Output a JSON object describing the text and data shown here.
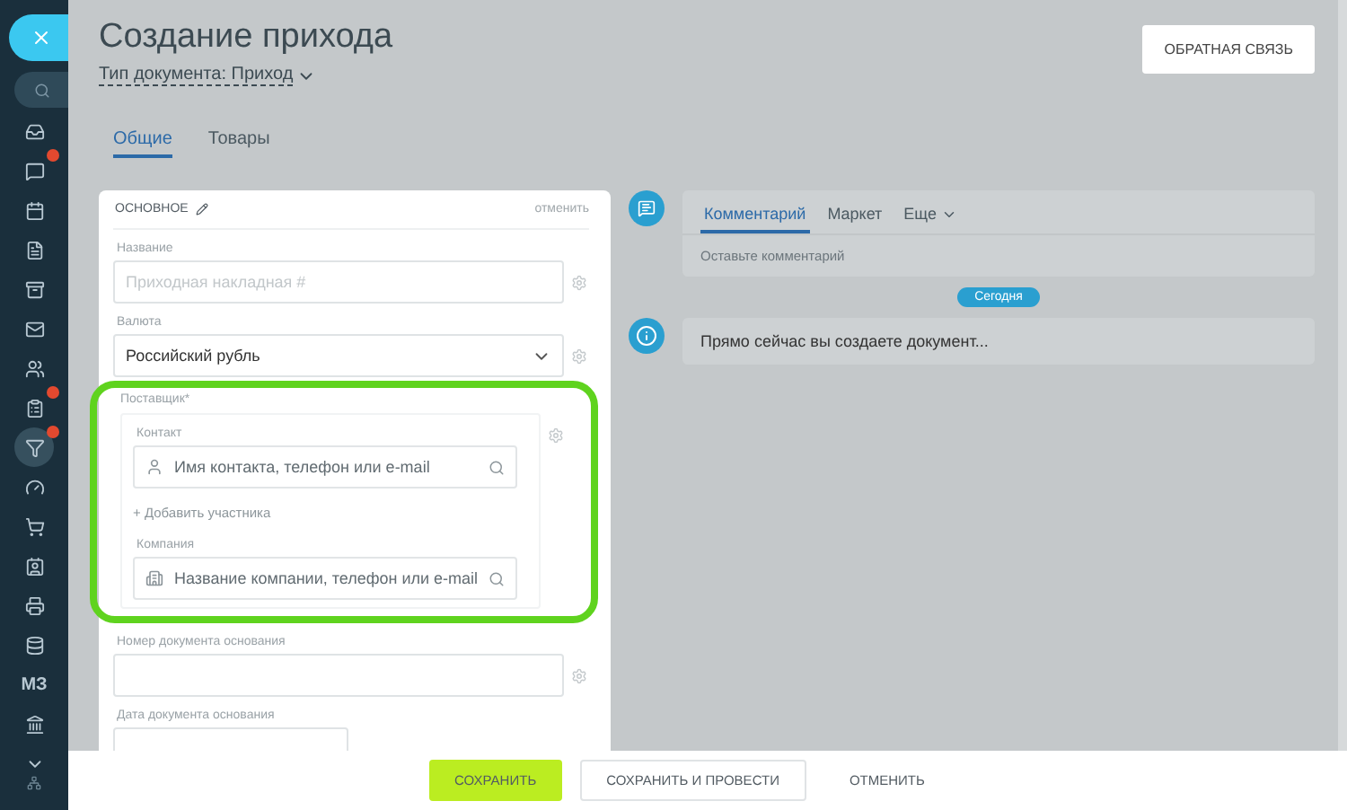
{
  "sidebar": {
    "items": [
      {
        "kind": "inbox",
        "badge": false,
        "selected": false
      },
      {
        "kind": "chat",
        "badge": true,
        "selected": false
      },
      {
        "kind": "calendar",
        "badge": false,
        "selected": false
      },
      {
        "kind": "document",
        "badge": false,
        "selected": false
      },
      {
        "kind": "archive",
        "badge": false,
        "selected": false
      },
      {
        "kind": "mail",
        "badge": false,
        "selected": false
      },
      {
        "kind": "users",
        "badge": false,
        "selected": false
      },
      {
        "kind": "tasks",
        "badge": true,
        "selected": false
      },
      {
        "kind": "filter",
        "badge": true,
        "selected": true
      },
      {
        "kind": "gauge",
        "badge": false,
        "selected": false
      },
      {
        "kind": "cart",
        "badge": false,
        "selected": false
      },
      {
        "kind": "contact",
        "badge": false,
        "selected": false
      },
      {
        "kind": "printer",
        "badge": false,
        "selected": false
      },
      {
        "kind": "database",
        "badge": false,
        "selected": false
      },
      {
        "kind": "text",
        "label": "МЗ",
        "badge": false,
        "selected": false
      },
      {
        "kind": "bank",
        "badge": false,
        "selected": false
      },
      {
        "kind": "more",
        "badge": false,
        "selected": false
      }
    ]
  },
  "title": "Создание прихода",
  "doc_type": "Тип документа: Приход",
  "feedback_button": "ОБРАТНАЯ СВЯЗЬ",
  "tabs": [
    {
      "label": "Общие",
      "selected": true
    },
    {
      "label": "Товары",
      "selected": false
    }
  ],
  "section": {
    "title": "ОСНОВНОЕ",
    "cancel": "отменить",
    "fields": [
      {
        "kind": "input",
        "label": "Название",
        "placeholder": "Приходная накладная #"
      },
      {
        "kind": "select",
        "label": "Валюта",
        "value": "Российский рубль"
      }
    ],
    "supplier": {
      "label": "Поставщик*",
      "highlighted": true,
      "contact": {
        "label": "Контакт",
        "placeholder": "Имя контакта, телефон или e-mail"
      },
      "add_link": "+ Добавить участника",
      "company": {
        "label": "Компания",
        "placeholder": "Название компании, телефон или e-mail"
      }
    },
    "more_fields": [
      {
        "kind": "input",
        "label": "Номер документа основания"
      },
      {
        "kind": "date",
        "label": "Дата документа основания"
      }
    ]
  },
  "timeline": {
    "tabs": [
      {
        "label": "Комментарий",
        "selected": true
      },
      {
        "label": "Маркет",
        "selected": false
      },
      {
        "label": "Еще",
        "selected": false
      }
    ],
    "comment_placeholder": "Оставьте комментарий",
    "date_badge": "Сегодня",
    "info_text": "Прямо сейчас вы создаете документ..."
  },
  "footer": {
    "buttons": [
      {
        "kind": "primary",
        "label": "СОХРАНИТЬ"
      },
      {
        "kind": "secondary",
        "label": "СОХРАНИТЬ И ПРОВЕСТИ"
      },
      {
        "kind": "link",
        "label": "ОТМЕНИТЬ"
      }
    ]
  }
}
